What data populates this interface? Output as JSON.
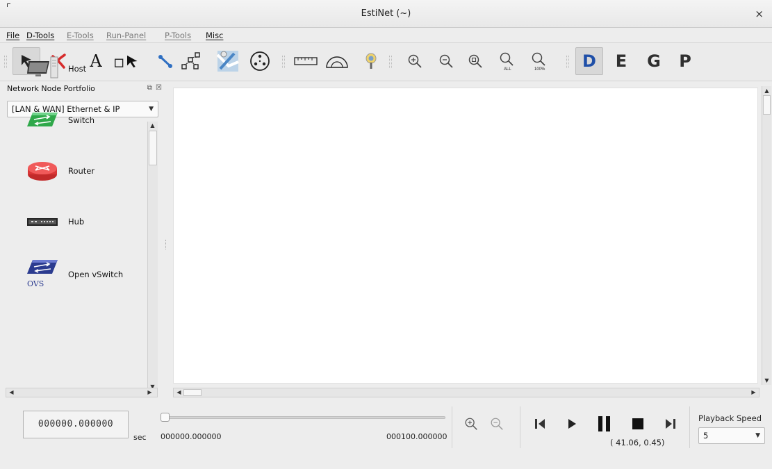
{
  "window": {
    "title": "EstiNet (~)",
    "close": "×"
  },
  "menu": [
    {
      "label": "File",
      "enabled": true
    },
    {
      "label": "D-Tools",
      "enabled": true
    },
    {
      "label": "E-Tools",
      "enabled": false
    },
    {
      "label": "Run-Panel",
      "enabled": false
    },
    {
      "label": "P-Tools",
      "enabled": false
    },
    {
      "label": "Misc",
      "enabled": true
    }
  ],
  "toolbar": {
    "tools": [
      {
        "name": "select-tool",
        "icon": "arrow-pointer-icon",
        "active": true
      },
      {
        "name": "delete-tool",
        "icon": "red-x-icon"
      },
      {
        "name": "text-tool",
        "icon": "letter-a-icon",
        "text": "A"
      },
      {
        "name": "rect-select-tool",
        "icon": "rect-select-icon"
      },
      {
        "name": "link-tool",
        "icon": "link-icon"
      },
      {
        "name": "topology-tool",
        "icon": "topology-icon"
      },
      {
        "name": "map-tool",
        "icon": "map-icon"
      },
      {
        "name": "node-group-tool",
        "icon": "node-circle-icon"
      },
      {
        "name": "ruler-tool",
        "icon": "ruler-icon"
      },
      {
        "name": "protractor-tool",
        "icon": "protractor-icon"
      },
      {
        "name": "antenna-tool",
        "icon": "antenna-icon"
      },
      {
        "name": "zoom-in-tool",
        "icon": "zoom-in-icon"
      },
      {
        "name": "zoom-out-tool",
        "icon": "zoom-out-icon"
      },
      {
        "name": "zoom-fit-tool",
        "icon": "zoom-fit-icon"
      },
      {
        "name": "zoom-all-tool",
        "icon": "zoom-all-icon",
        "caption": "ALL"
      },
      {
        "name": "zoom-100-tool",
        "icon": "zoom-100-icon",
        "caption": "100%"
      }
    ],
    "modes": [
      {
        "label": "D",
        "active": true
      },
      {
        "label": "E"
      },
      {
        "label": "G"
      },
      {
        "label": "P"
      }
    ]
  },
  "portfolio": {
    "title": "Network Node Portfolio",
    "controls": "⧉ ☒",
    "category": "[LAN & WAN] Ethernet & IP",
    "nodes": [
      {
        "label": "Host",
        "icon": "host-computer-icon"
      },
      {
        "label": "Switch",
        "icon": "switch-icon"
      },
      {
        "label": "Router",
        "icon": "router-icon"
      },
      {
        "label": "Hub",
        "icon": "hub-icon"
      },
      {
        "label": "Open vSwitch",
        "icon": "openvswitch-icon",
        "badge": "OVS"
      }
    ]
  },
  "playback": {
    "time_display": "000000.000000",
    "time_unit": "sec",
    "start_time": "000000.000000",
    "end_time": "000100.000000",
    "position": 0.0,
    "speed_label": "Playback Speed",
    "speed_value": "5"
  },
  "status": {
    "coordinates": "( 41.06, 0.45)"
  },
  "colors": {
    "accent_red": "#d62b2b",
    "router_red": "#e23b3b",
    "switch_green": "#2fa84a",
    "link_blue": "#2f6fc2"
  }
}
